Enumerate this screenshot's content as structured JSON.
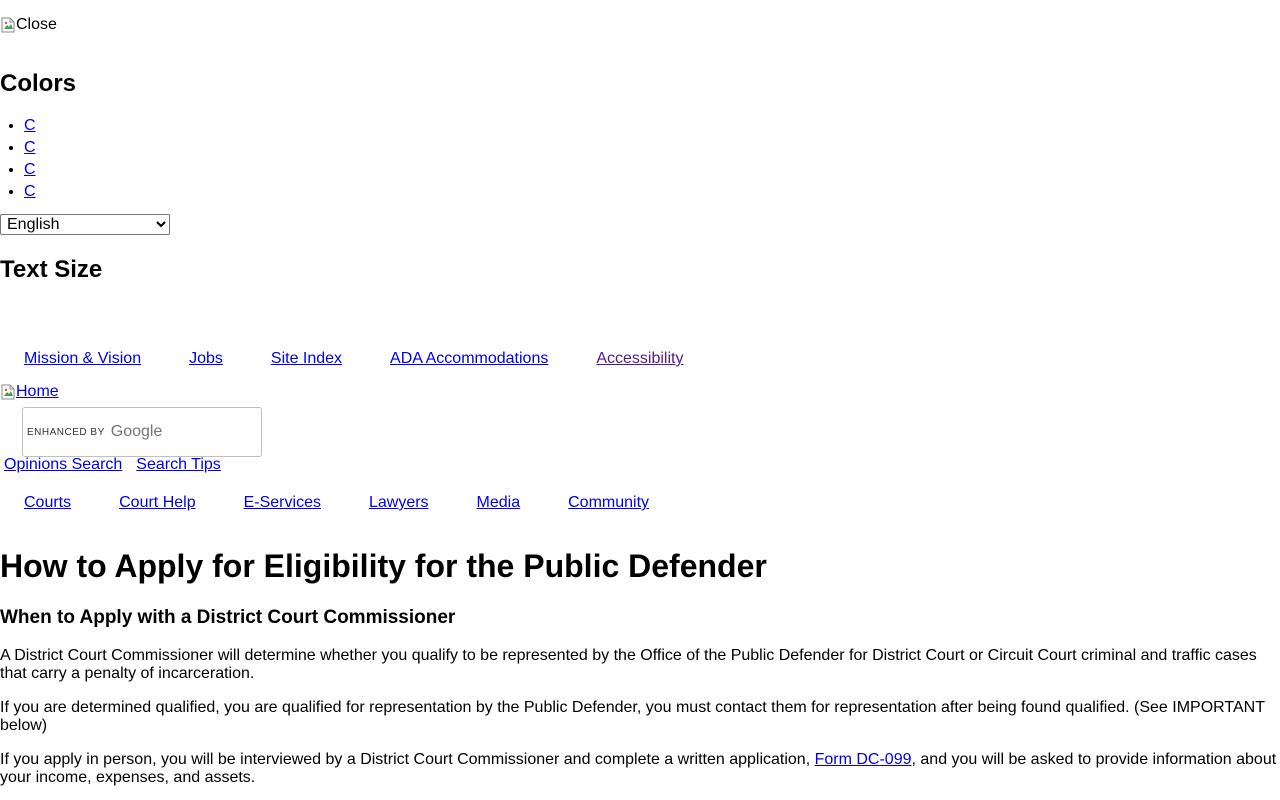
{
  "close": {
    "alt": "Close"
  },
  "colors": {
    "heading": "Colors",
    "swatches": [
      {
        "label": "C"
      },
      {
        "label": "C"
      },
      {
        "label": "C"
      },
      {
        "label": "C"
      }
    ]
  },
  "language": {
    "selected": "English"
  },
  "text_size": {
    "heading": "Text Size"
  },
  "utility_nav": {
    "items": [
      {
        "label": "Mission & Vision"
      },
      {
        "label": "Jobs"
      },
      {
        "label": "Site Index"
      },
      {
        "label": "ADA Accommodations"
      },
      {
        "label": "Accessibility"
      }
    ]
  },
  "home": {
    "alt": "Home"
  },
  "search": {
    "enhanced_by": "ENHANCED BY",
    "google": "Google",
    "links": [
      {
        "label": "Opinions Search"
      },
      {
        "label": "Search Tips"
      }
    ]
  },
  "main_nav": {
    "items": [
      {
        "label": "Courts"
      },
      {
        "label": "Court Help"
      },
      {
        "label": "E-Services"
      },
      {
        "label": "Lawyers"
      },
      {
        "label": "Media"
      },
      {
        "label": "Community"
      }
    ]
  },
  "content": {
    "title": "How to Apply for Eligibility for the Public Defender",
    "section_heading": "When to Apply with a District Court Commissioner",
    "paragraph1": "A District Court Commissioner will determine whether you qualify to be represented by the Office of the Public Defender for District Court or Circuit Court criminal and traffic cases that carry a penalty of incarceration.",
    "paragraph2": "If you are determined qualified, you are qualified for representation by the Public Defender, you must contact them for representation after being found qualified. (See IMPORTANT below)",
    "paragraph3_before": "If you apply in person, you will be interviewed by a District Court Commissioner and complete a written application, ",
    "paragraph3_link": "Form DC-099",
    "paragraph3_after": ", and you will be asked to provide information about your income, expenses, and assets."
  }
}
